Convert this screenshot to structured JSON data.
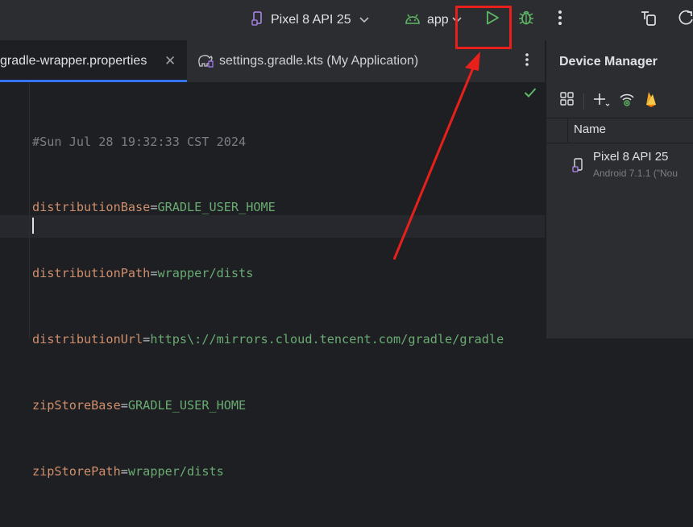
{
  "toolbar": {
    "device": "Pixel 8 API 25",
    "app": "app"
  },
  "tabs": [
    {
      "label": "gradle-wrapper.properties",
      "active": true
    },
    {
      "label": "settings.gradle.kts (My Application)",
      "active": false
    }
  ],
  "editor": {
    "lines": [
      {
        "key": "#Sun Jul 28 19:32:33 CST 2024",
        "eq": "",
        "val": "",
        "comment": true
      },
      {
        "key": "distributionBase",
        "eq": "=",
        "val": "GRADLE_USER_HOME"
      },
      {
        "key": "distributionPath",
        "eq": "=",
        "val": "wrapper/dists"
      },
      {
        "key": "distributionUrl",
        "eq": "=",
        "val": "https\\://mirrors.cloud.tencent.com/gradle/gradle"
      },
      {
        "key": "zipStoreBase",
        "eq": "=",
        "val": "GRADLE_USER_HOME"
      },
      {
        "key": "zipStorePath",
        "eq": "=",
        "val": "wrapper/dists"
      }
    ]
  },
  "device_manager": {
    "title": "Device Manager",
    "column": "Name",
    "device": {
      "name": "Pixel 8 API 25",
      "detail": "Android 7.1.1 (\"Nou"
    }
  },
  "colors": {
    "accent": "#3574f0",
    "run_green": "#5fb865",
    "highlight_red": "#e8201b"
  }
}
